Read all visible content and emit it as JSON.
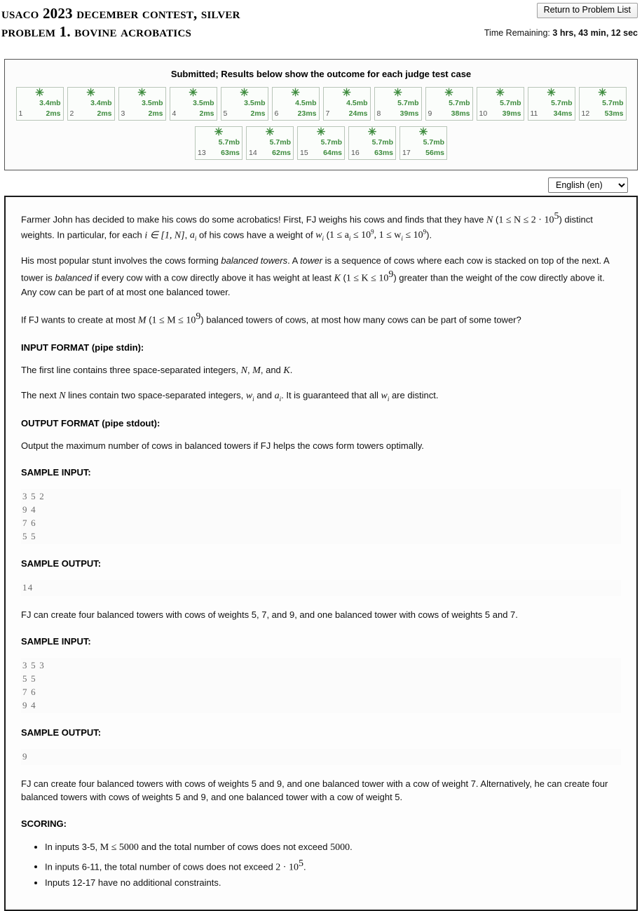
{
  "header": {
    "contest_title": "USACO 2023 December Contest, Silver",
    "problem_title": "Problem 1. Bovine Acrobatics",
    "return_button": "Return to Problem List",
    "time_label": "Time Remaining:",
    "time_value": "3 hrs, 43 min, 12 sec"
  },
  "results": {
    "heading": "Submitted; Results below show the outcome for each judge test case",
    "status_glyph": "✳",
    "cases": [
      {
        "num": "1",
        "mem": "3.4mb",
        "time": "2ms"
      },
      {
        "num": "2",
        "mem": "3.4mb",
        "time": "2ms"
      },
      {
        "num": "3",
        "mem": "3.5mb",
        "time": "2ms"
      },
      {
        "num": "4",
        "mem": "3.5mb",
        "time": "2ms"
      },
      {
        "num": "5",
        "mem": "3.5mb",
        "time": "2ms"
      },
      {
        "num": "6",
        "mem": "4.5mb",
        "time": "23ms"
      },
      {
        "num": "7",
        "mem": "4.5mb",
        "time": "24ms"
      },
      {
        "num": "8",
        "mem": "5.7mb",
        "time": "39ms"
      },
      {
        "num": "9",
        "mem": "5.7mb",
        "time": "38ms"
      },
      {
        "num": "10",
        "mem": "5.7mb",
        "time": "39ms"
      },
      {
        "num": "11",
        "mem": "5.7mb",
        "time": "34ms"
      },
      {
        "num": "12",
        "mem": "5.7mb",
        "time": "53ms"
      },
      {
        "num": "13",
        "mem": "5.7mb",
        "time": "63ms"
      },
      {
        "num": "14",
        "mem": "5.7mb",
        "time": "62ms"
      },
      {
        "num": "15",
        "mem": "5.7mb",
        "time": "64ms"
      },
      {
        "num": "16",
        "mem": "5.7mb",
        "time": "63ms"
      },
      {
        "num": "17",
        "mem": "5.7mb",
        "time": "56ms"
      }
    ],
    "pass_color": "#3d8b3d"
  },
  "language": {
    "selected": "English (en)",
    "chevron": "⌄"
  },
  "problem": {
    "para1_a": "Farmer John has decided to make his cows do some acrobatics! First, FJ weighs his cows and finds that they have ",
    "para1_N": "N",
    "para1_b": " (",
    "para1_range1": "1 ≤ N ≤ 2 · 10",
    "para1_exp1": "5",
    "para1_c": ") distinct weights. In particular, for each ",
    "para1_i": "i ∈ [1, N]",
    "para1_d": ", ",
    "para1_ai": "a",
    "para1_ai_sub": "i",
    "para1_e": " of his cows have a weight of ",
    "para1_wi": "w",
    "para1_wi_sub": "i",
    "para1_f": " (",
    "para1_range2": "1 ≤ a",
    "para1_range2_sub": "i",
    "para1_range2b": " ≤ 10",
    "para1_exp2": "9",
    "para1_range3": ", 1 ≤ w",
    "para1_range3_sub": "i",
    "para1_range3b": " ≤ 10",
    "para1_exp3": "9",
    "para1_g": ").",
    "para2_a": "His most popular stunt involves the cows forming ",
    "para2_em1": "balanced towers",
    "para2_b": ". A ",
    "para2_em2": "tower",
    "para2_c": " is a sequence of cows where each cow is stacked on top of the next. A tower is ",
    "para2_em3": "balanced",
    "para2_d": " if every cow with a cow directly above it has weight at least ",
    "para2_K": "K",
    "para2_e": " (",
    "para2_range": "1 ≤ K ≤ 10",
    "para2_exp": "9",
    "para2_f": ") greater than the weight of the cow directly above it. Any cow can be part of at most one balanced tower.",
    "para3_a": "If FJ wants to create at most ",
    "para3_M": "M",
    "para3_b": " (",
    "para3_range": "1 ≤ M ≤ 10",
    "para3_exp": "9",
    "para3_c": ") balanced towers of cows, at most how many cows can be part of some tower?",
    "input_format_heading": "INPUT FORMAT (pipe stdin):",
    "input_line1_a": "The first line contains three space-separated integers, ",
    "input_line1_N": "N",
    "input_line1_b": ", ",
    "input_line1_M": "M",
    "input_line1_c": ", and ",
    "input_line1_K": "K",
    "input_line1_d": ".",
    "input_line2_a": "The next ",
    "input_line2_N": "N",
    "input_line2_b": " lines contain two space-separated integers, ",
    "input_line2_w": "w",
    "input_line2_w_sub": "i",
    "input_line2_c": " and ",
    "input_line2_a2": "a",
    "input_line2_a_sub": "i",
    "input_line2_d": ". It is guaranteed that all ",
    "input_line2_w2": "w",
    "input_line2_w2_sub": "i",
    "input_line2_e": " are distinct.",
    "output_format_heading": "OUTPUT FORMAT (pipe stdout):",
    "output_desc": "Output the maximum number of cows in balanced towers if FJ helps the cows form towers optimally.",
    "sample_input_heading_1": "SAMPLE INPUT:",
    "sample_input_1": "3 5 2\n9 4\n7 6\n5 5",
    "sample_output_heading_1": "SAMPLE OUTPUT:",
    "sample_output_1": "14",
    "sample_explain_1": "FJ can create four balanced towers with cows of weights 5, 7, and 9, and one balanced tower with cows of weights 5 and 7.",
    "sample_input_heading_2": "SAMPLE INPUT:",
    "sample_input_2": "3 5 3\n5 5\n7 6\n9 4",
    "sample_output_heading_2": "SAMPLE OUTPUT:",
    "sample_output_2": "9",
    "sample_explain_2a": "FJ can create four balanced towers with cows of weights 5 and 9, and one balanced tower with a cow of weight 7. Alternatively,",
    "sample_explain_2b": "he can create four balanced towers with cows of weights 5 and 9, and one balanced tower with a cow of weight 5.",
    "scoring_heading": "SCORING:",
    "scoring": {
      "item1_a": "In inputs 3-5, ",
      "item1_m": "M ≤ 5000",
      "item1_b": " and the total number of cows does not exceed ",
      "item1_n": "5000",
      "item1_c": ".",
      "item2_a": "In inputs 6-11, the total number of cows does not exceed ",
      "item2_m": "2 · 10",
      "item2_exp": "5",
      "item2_b": ".",
      "item3": "Inputs 12-17 have no additional constraints."
    }
  }
}
